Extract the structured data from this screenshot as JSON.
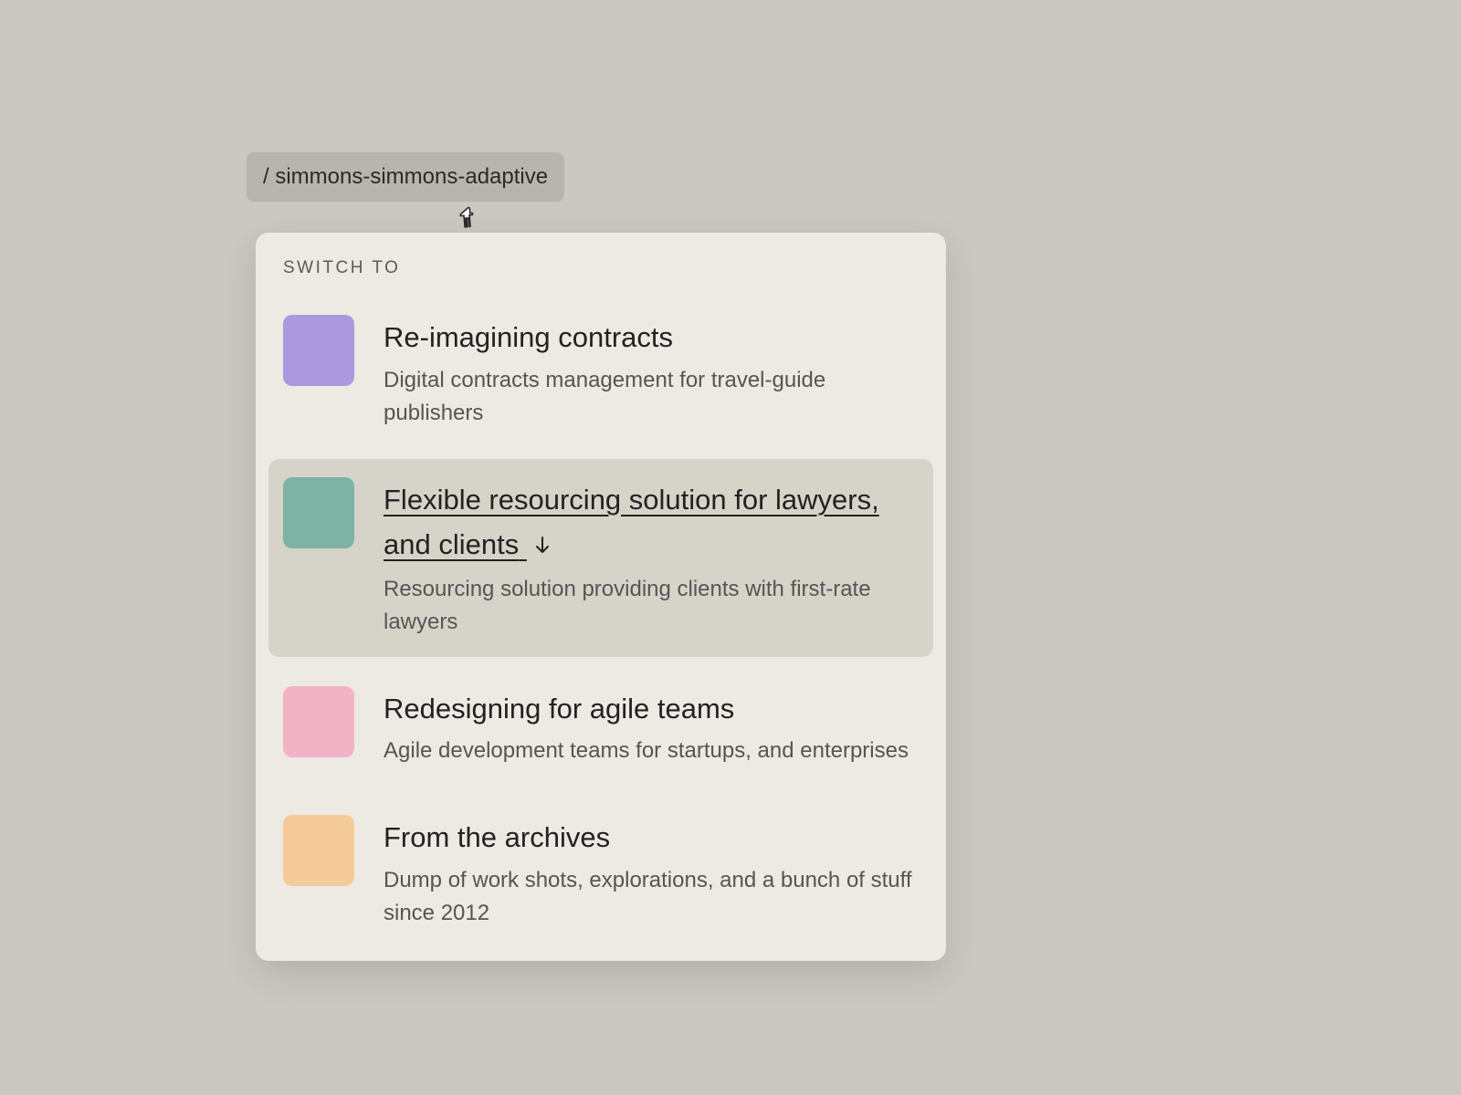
{
  "breadcrumb": {
    "text": "/ simmons-simmons-adaptive"
  },
  "dropdown": {
    "heading": "SWITCH TO",
    "items": [
      {
        "title": "Re-imagining contracts",
        "subtitle": "Digital contracts management for travel-guide publishers",
        "swatch": "#ab99df",
        "highlighted": false
      },
      {
        "title": "Flexible resourcing solution for lawyers, and clients",
        "subtitle": "Resourcing solution providing clients with first-rate lawyers",
        "swatch": "#7eb3a4",
        "highlighted": true
      },
      {
        "title": "Redesigning for agile teams",
        "subtitle": "Agile development teams for startups, and enterprises",
        "swatch": "#f2b3c7",
        "highlighted": false
      },
      {
        "title": "From the archives",
        "subtitle": "Dump of work shots, explorations, and a bunch of stuff since 2012",
        "swatch": "#f4cb98",
        "highlighted": false
      }
    ]
  }
}
